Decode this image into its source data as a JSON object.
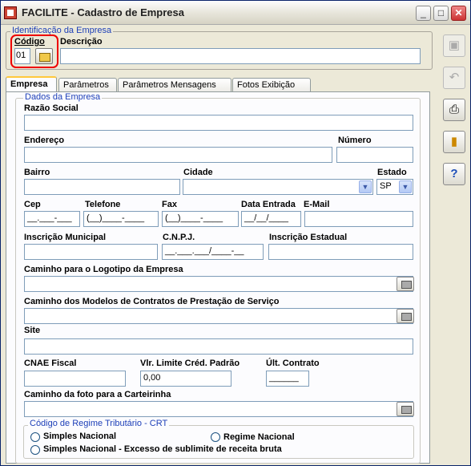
{
  "window": {
    "title": "FACILITE - Cadastro de Empresa"
  },
  "ident": {
    "legend": "Identificação da Empresa",
    "codigo_label": "Código",
    "codigo_value": "01",
    "descricao_label": "Descrição",
    "descricao_value": ""
  },
  "tabs": [
    {
      "label": "Empresa"
    },
    {
      "label": "Parâmetros"
    },
    {
      "label": "Parâmetros Mensagens"
    },
    {
      "label": "Fotos Exibição"
    }
  ],
  "dados": {
    "legend": "Dados da Empresa",
    "razao_label": "Razão Social",
    "endereco_label": "Endereço",
    "numero_label": "Número",
    "bairro_label": "Bairro",
    "cidade_label": "Cidade",
    "estado_label": "Estado",
    "estado_value": "SP",
    "cep_label": "Cep",
    "cep_value": "__.___-___",
    "telefone_label": "Telefone",
    "telefone_value": "(__)____-____",
    "fax_label": "Fax",
    "fax_value": "(__)____-____",
    "data_entrada_label": "Data Entrada",
    "data_entrada_value": "__/__/____",
    "email_label": "E-Mail",
    "insc_mun_label": "Inscrição Municipal",
    "cnpj_label": "C.N.P.J.",
    "cnpj_value": "__.___.___/____-__",
    "insc_est_label": "Inscrição Estadual",
    "logo_label": "Caminho para o Logotipo da Empresa",
    "modelos_label": "Caminho dos Modelos de Contratos de Prestação de Serviço",
    "site_label": "Site",
    "cnae_label": "CNAE Fiscal",
    "limite_label": "Vlr. Limite Créd. Padrão",
    "limite_value": "0,00",
    "ult_contrato_label": "Últ. Contrato",
    "ult_contrato_value": "______",
    "foto_label": "Caminho da foto para a Carteirinha"
  },
  "crt": {
    "legend": "Código de Regime Tributário - CRT",
    "opt1": "Simples Nacional",
    "opt2": "Regime Nacional",
    "opt3": "Simples Nacional - Excesso de sublimite de receita bruta"
  },
  "side_icons": [
    "save-icon",
    "undo-icon",
    "print-icon",
    "exit-icon",
    "help-icon"
  ]
}
